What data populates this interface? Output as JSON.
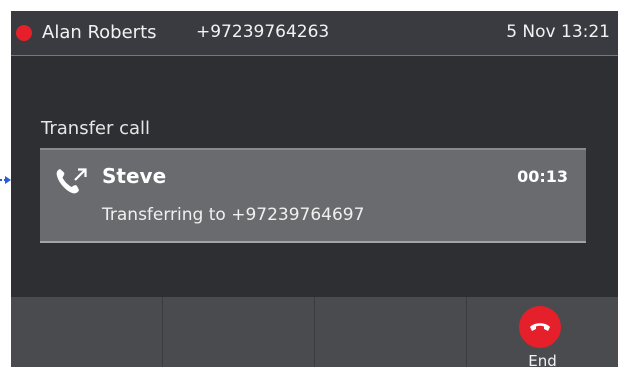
{
  "status_bar": {
    "caller_name": "Alan Roberts",
    "caller_number": "+97239764263",
    "datetime": "5 Nov 13:21",
    "status_color": "#e5202a"
  },
  "section_title": "Transfer call",
  "call": {
    "contact_name": "Steve",
    "duration": "00:13",
    "status_text": "Transferring to +97239764697",
    "icon": "outgoing-call-icon"
  },
  "softkeys": [
    {
      "label": ""
    },
    {
      "label": ""
    },
    {
      "label": ""
    },
    {
      "label": "End",
      "icon": "hang-up-icon",
      "color": "#e5202a"
    }
  ]
}
